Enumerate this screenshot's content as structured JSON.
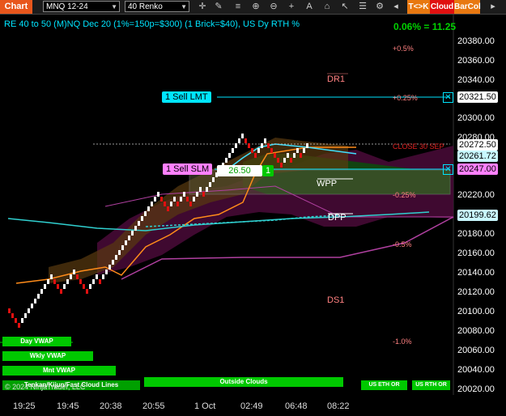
{
  "toolbar": {
    "chart_tab": "Chart",
    "instrument": "MNQ 12-24",
    "bar_type": "40 Renko",
    "tc_button": "T<>K",
    "cloud_button": "Cloud",
    "barcol_button": "BarCol",
    "icons": [
      "crosshair-icon",
      "draw-icon",
      "zoom-in-icon",
      "zoom-out-icon",
      "plus-icon",
      "lines-icon",
      "text-icon",
      "shapes-icon",
      "cursor-icon",
      "list-icon",
      "copy-icon",
      "properties-icon",
      "chevron-icon",
      "back-icon"
    ]
  },
  "chart": {
    "title": "RE 40 to 50 (M)NQ Dec 20 (1%=150p=$300) (1 Brick=$40), US Dy RTH %",
    "pct_readout": "0.06% = 11.25",
    "levels": {
      "dr1": "DR1",
      "wpp": "WPP",
      "dpp": "DPP",
      "ds1": "DS1"
    },
    "pct_labels": {
      "p05": "+0.5%",
      "p025": "+0.25%",
      "close": "CLOSE 30 SEP",
      "m025": "-0.25%",
      "m05": "-0.5%",
      "m10": "-1.0%"
    },
    "orders": {
      "sell_lmt": "1 Sell LMT",
      "sell_slm": "1 Sell SLM",
      "slm_price": "26.50",
      "slm_qty": "1"
    },
    "price_axis": [
      "20380.00",
      "20360.00",
      "20340.00",
      "20300.00",
      "20280.00",
      "20220.00",
      "20180.00",
      "20160.00",
      "20140.00",
      "20120.00",
      "20100.00",
      "20080.00",
      "20060.00",
      "20040.00",
      "20020.00"
    ],
    "price_tags": {
      "lmt": "20321.50",
      "last": "20272.50",
      "ema": "20261.72",
      "slm": "20247.00",
      "dpp": "20199.62"
    },
    "time_axis": [
      "19:25",
      "19:45",
      "20:38",
      "20:55",
      "1 Oct",
      "02:49",
      "06:48",
      "08:22"
    ],
    "vwap_buttons": {
      "day": "Day VWAP",
      "wkly": "Wkly VWAP",
      "mnt": "Mnt VWAP",
      "ichimoku": "Tenkan/Kijun/Fast Cloud Lines",
      "outside": "Outside Clouds",
      "us_eth": "US ETH OR",
      "us_rth": "US RTH OR"
    },
    "copyright": "© 2024 NinjaTrader, LLC",
    "colors": {
      "up_brick": "#ffffff",
      "down_brick": "#e01010",
      "cloud_bull": "#004d00",
      "cloud_bear": "#4a0a38",
      "accent_cyan": "#00e5ff",
      "order_pink": "#ff80ff"
    }
  }
}
